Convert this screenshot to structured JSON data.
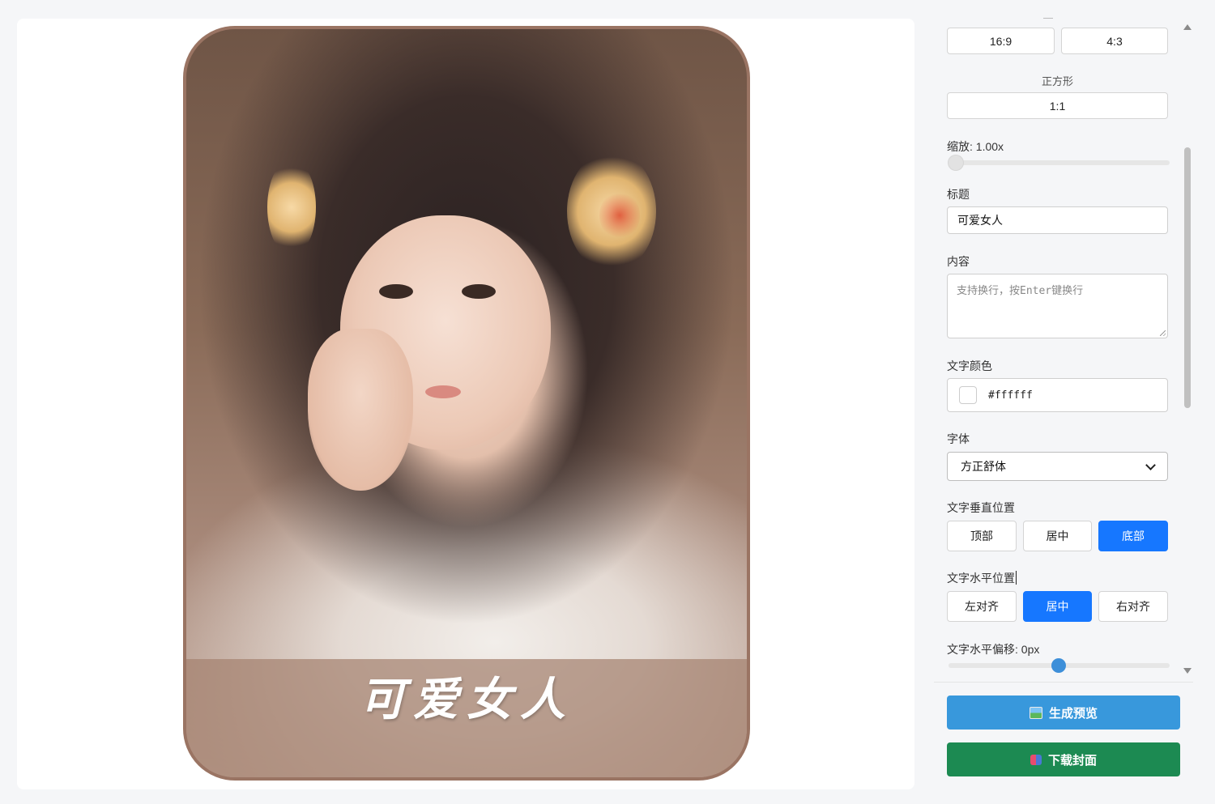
{
  "preview": {
    "cover_title": "可爱女人",
    "colors": {
      "border": "#9a7463",
      "banner": "#a58270"
    }
  },
  "aspect_ratios": {
    "buttons": [
      "16:9",
      "4:3"
    ],
    "square_label": "正方形",
    "square_button": "1:1"
  },
  "scale": {
    "label": "缩放: 1.00x",
    "value": 1.0
  },
  "title_field": {
    "label": "标题",
    "value": "可爱女人"
  },
  "content_field": {
    "label": "内容",
    "placeholder": "支持换行，按Enter键换行"
  },
  "text_color": {
    "label": "文字颜色",
    "value": "#ffffff"
  },
  "font": {
    "label": "字体",
    "selected": "方正舒体"
  },
  "vertical_position": {
    "label": "文字垂直位置",
    "options": [
      "顶部",
      "居中",
      "底部"
    ],
    "selected": "底部"
  },
  "horizontal_position": {
    "label": "文字水平位置",
    "options": [
      "左对齐",
      "居中",
      "右对齐"
    ],
    "selected": "居中"
  },
  "horizontal_offset": {
    "label": "文字水平偏移: 0px",
    "value": 0
  },
  "actions": {
    "preview_label": "生成预览",
    "preview_icon": "picture-icon",
    "download_label": "下载封面",
    "download_icon": "book-icon"
  },
  "theme": {
    "accent": "#1677ff",
    "preview_button": "#3898dc",
    "download_button": "#1c8a52"
  }
}
